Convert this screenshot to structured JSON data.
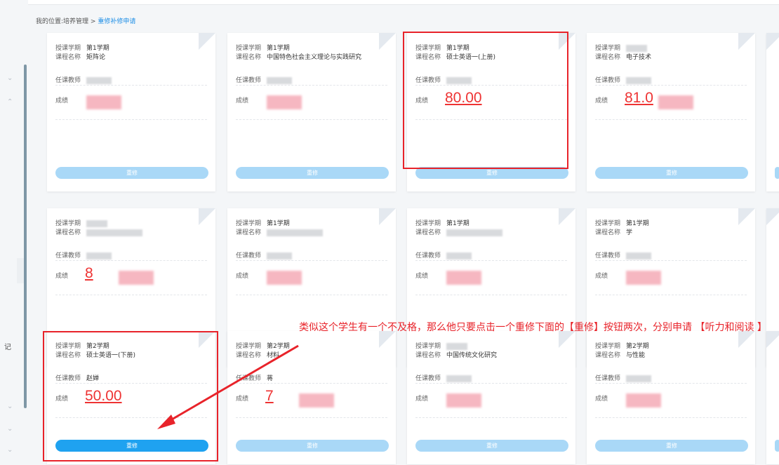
{
  "breadcrumb": {
    "prefix": "我的位置:",
    "section": "培养管理",
    "sep": " > ",
    "current": "重修补修申请"
  },
  "sidebar": {
    "label": "记"
  },
  "labels": {
    "semester": "授课学期",
    "course": "课程名称",
    "teacher": "任课教师",
    "grade": "成绩",
    "button": "重修"
  },
  "cards": [
    {
      "semester": "第1学期",
      "course": "矩阵论",
      "teacher": "",
      "grade": ""
    },
    {
      "semester": "第1学期",
      "course": "中国特色社会主义理论与实践研究",
      "teacher": "",
      "grade": ""
    },
    {
      "semester": "第1学期",
      "course": "硕士英语一(上册)",
      "teacher": "",
      "grade": "80.00"
    },
    {
      "semester": "",
      "course": "电子技术",
      "teacher": "",
      "grade": "81.0"
    },
    {
      "semester": "",
      "course": "",
      "teacher": "",
      "grade": "8"
    },
    {
      "semester": "第1学期",
      "course": "",
      "teacher": "",
      "grade": ""
    },
    {
      "semester": "第1学期",
      "course": "",
      "teacher": "",
      "grade": ""
    },
    {
      "semester": "第1学期",
      "course": "学",
      "teacher": "",
      "grade": ""
    },
    {
      "semester": "第2学期",
      "course": "硕士英语一(下册)",
      "teacher": "赵婵",
      "grade": "50.00"
    },
    {
      "semester": "第2学期",
      "course": "材料",
      "teacher": "蒋",
      "grade": "7"
    },
    {
      "semester": "",
      "course": "中国传统文化研究",
      "teacher": "",
      "grade": ""
    },
    {
      "semester": "第2学期",
      "course": "与性能",
      "teacher": "",
      "grade": ""
    }
  ],
  "annotation": "类似这个学生有一个不及格，那么他只要点击一个重修下面的【重修】按钮两次，分别申请 【听力和阅读 】"
}
